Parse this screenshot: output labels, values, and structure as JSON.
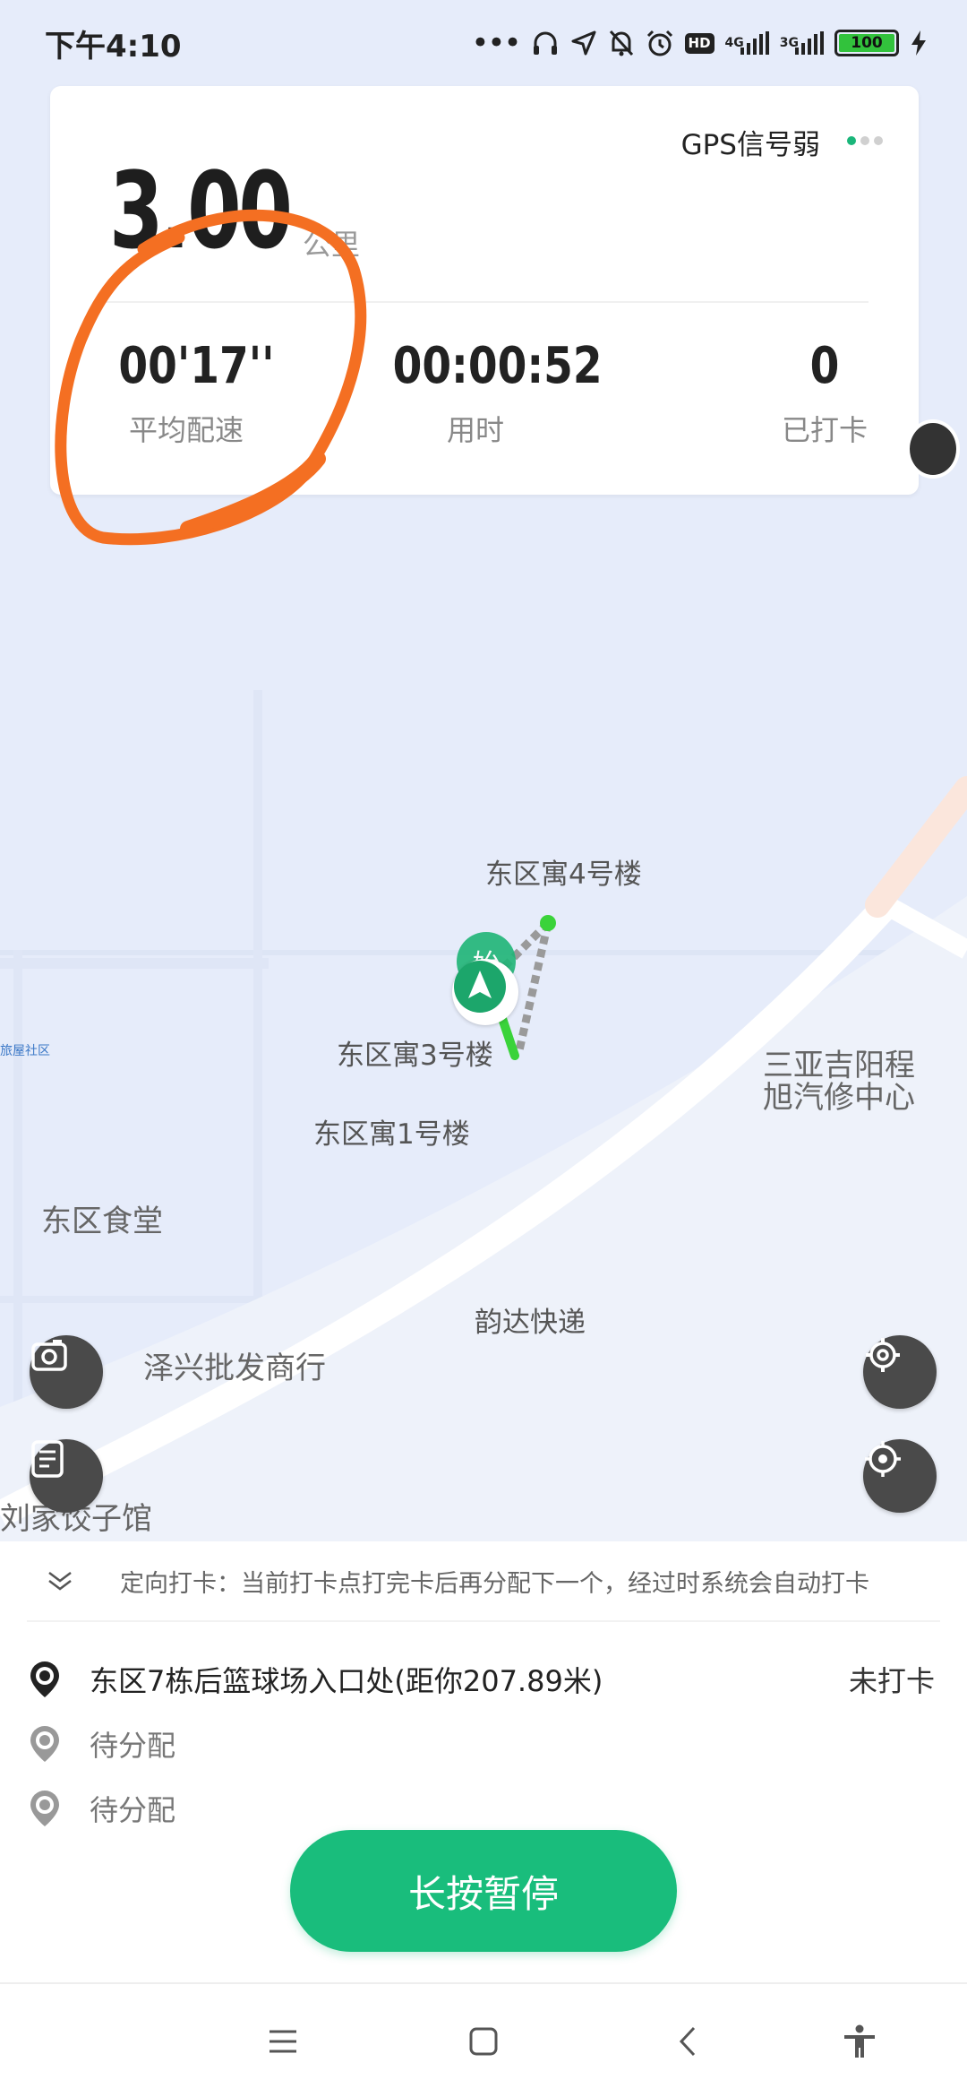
{
  "status_bar": {
    "time": "下午4:10",
    "network_1": "4G",
    "network_2": "3G",
    "battery": "100",
    "icons": [
      "more-dots-icon",
      "headphones-icon",
      "location-arrow-icon",
      "bell-off-icon",
      "alarm-icon",
      "hd-icon",
      "signal-icon",
      "signal-icon",
      "battery-icon",
      "charging-icon"
    ]
  },
  "stats": {
    "gps_status": "GPS信号弱",
    "distance": "3.00",
    "distance_unit": "公里",
    "pace_value": "00'17''",
    "pace_label": "平均配速",
    "time_value": "00:00:52",
    "time_label": "用时",
    "checkin_value": "0",
    "checkin_label": "已打卡"
  },
  "map": {
    "labels": {
      "building4": "东区寓4号楼",
      "building3": "东区寓3号楼",
      "building1": "东区寓1号楼",
      "canteen": "东区食堂",
      "repair_line1": "三亚吉阳程",
      "repair_line2": "旭汽修中心",
      "express": "韵达快递",
      "wholesale": "泽兴批发商行",
      "dumpling": "刘家饺子馆",
      "community": "旅屋社区"
    },
    "start_marker": "始"
  },
  "panel": {
    "notice": "定向打卡：当前打卡点打完卡后再分配下一个，经过时系统会自动打卡",
    "checkpoints": [
      {
        "name": "东区7栋后篮球场入口处(距你207.89米)",
        "status": "未打卡"
      },
      {
        "name": "待分配",
        "status": ""
      },
      {
        "name": "待分配",
        "status": ""
      }
    ],
    "pause_button": "长按暂停"
  },
  "colors": {
    "accent": "#19bd7c",
    "annotation": "#f46f22",
    "route": "#3ad33a"
  }
}
